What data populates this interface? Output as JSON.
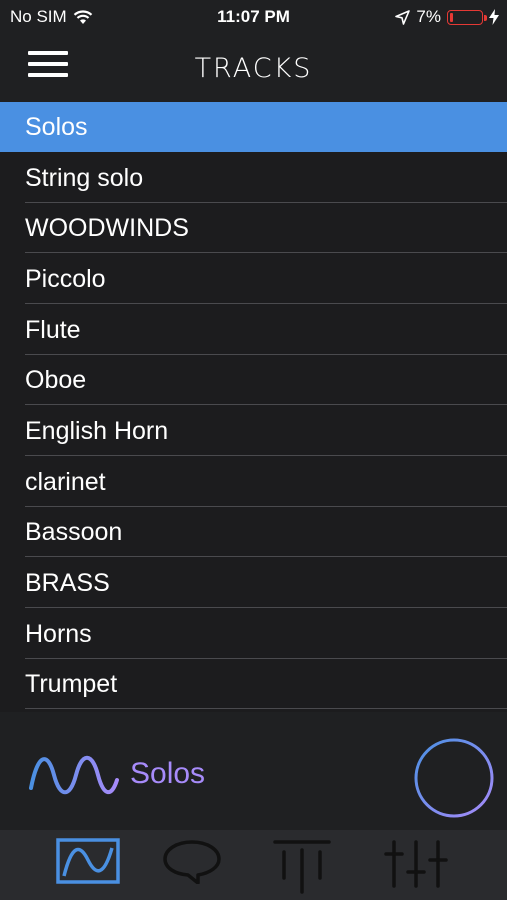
{
  "status": {
    "carrier": "No SIM",
    "time": "11:07 PM",
    "battery": "7%"
  },
  "nav": {
    "title": "TRACKS"
  },
  "tracks": [
    {
      "label": "Solos",
      "selected": true
    },
    {
      "label": "String solo"
    },
    {
      "label": "WOODWINDS"
    },
    {
      "label": "Piccolo"
    },
    {
      "label": "Flute"
    },
    {
      "label": "Oboe"
    },
    {
      "label": "English Horn"
    },
    {
      "label": "clarinet"
    },
    {
      "label": "Bassoon"
    },
    {
      "label": "BRASS"
    },
    {
      "label": "Horns"
    },
    {
      "label": "Trumpet"
    }
  ],
  "player": {
    "current_track": "Solos"
  },
  "tabs": [
    {
      "icon": "waveform-icon",
      "active": true
    },
    {
      "icon": "chat-bubble-icon"
    },
    {
      "icon": "tuning-fork-icon"
    },
    {
      "icon": "mixer-sliders-icon"
    }
  ],
  "colors": {
    "accent": "#4a90e2",
    "gradient_start": "#4a90e2",
    "gradient_end": "#a78bfa",
    "battery_low": "#e53935"
  }
}
